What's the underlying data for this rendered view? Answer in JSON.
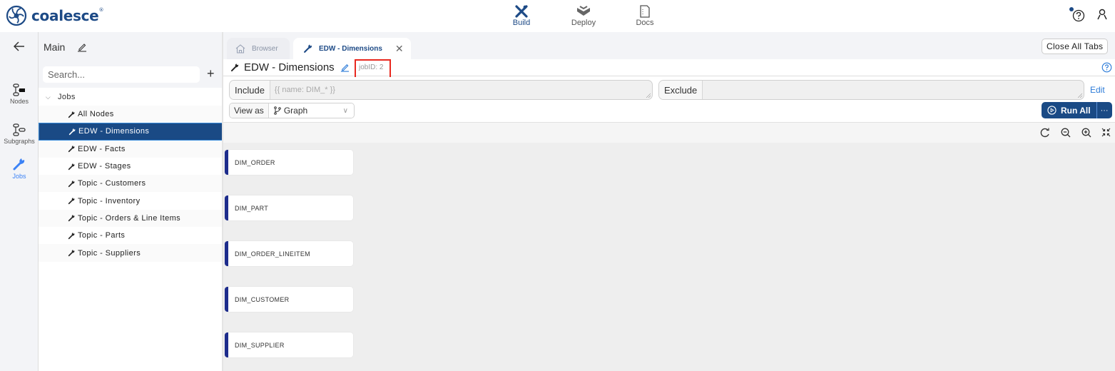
{
  "app": {
    "brand": "coalesce",
    "brand_mark": "®",
    "nav": [
      {
        "label": "Build",
        "icon": "tools-icon",
        "active": true
      },
      {
        "label": "Deploy",
        "icon": "deploy-icon",
        "active": false
      },
      {
        "label": "Docs",
        "icon": "docs-icon",
        "active": false
      }
    ]
  },
  "rail": {
    "items": [
      {
        "label": "Nodes",
        "icon": "nodes-icon"
      },
      {
        "label": "Subgraphs",
        "icon": "subgraphs-icon"
      },
      {
        "label": "Jobs",
        "icon": "wrench-icon",
        "active": true
      }
    ]
  },
  "sidepanel": {
    "title": "Main",
    "search_placeholder": "Search...",
    "group_label": "Jobs",
    "items": [
      {
        "label": "All Nodes"
      },
      {
        "label": "EDW - Dimensions",
        "selected": true
      },
      {
        "label": "EDW - Facts"
      },
      {
        "label": "EDW - Stages"
      },
      {
        "label": "Topic - Customers"
      },
      {
        "label": "Topic - Inventory"
      },
      {
        "label": "Topic - Orders & Line Items"
      },
      {
        "label": "Topic - Parts"
      },
      {
        "label": "Topic - Suppliers"
      }
    ]
  },
  "tabs": [
    {
      "label": "Browser",
      "icon": "home-icon"
    },
    {
      "label": "EDW - Dimensions",
      "icon": "wrench-icon",
      "active": true
    }
  ],
  "toolbar": {
    "close_all_label": "Close All Tabs",
    "page_title": "EDW - Dimensions",
    "job_id": "jobID: 2",
    "include_label": "Include",
    "include_placeholder": "{{ name: DIM_* }}",
    "exclude_label": "Exclude",
    "exclude_value": "",
    "edit_label": "Edit",
    "view_as_label": "View as",
    "view_as_value": "Graph",
    "run_all_label": "Run All",
    "more_label": "···"
  },
  "graph": {
    "nodes": [
      "DIM_ORDER",
      "DIM_PART",
      "DIM_ORDER_LINEITEM",
      "DIM_CUSTOMER",
      "DIM_SUPPLIER"
    ]
  },
  "colors": {
    "brand": "#1d4a86",
    "selected": "#1a4a85",
    "link": "#2b7bd8",
    "node_accent": "#1d2c8c",
    "highlight_box": "#e8281f"
  }
}
